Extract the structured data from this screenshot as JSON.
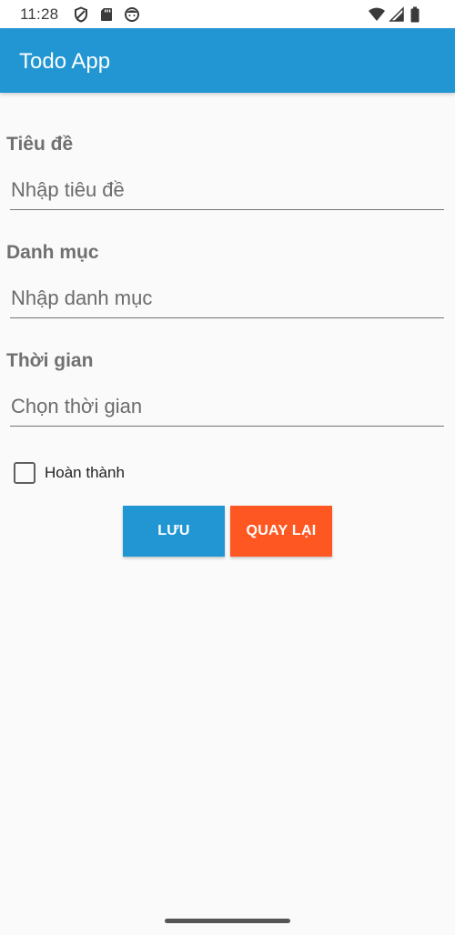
{
  "status_bar": {
    "time": "11:28",
    "left_icons": [
      "shield-icon",
      "sd-card-icon",
      "face-icon"
    ],
    "right_icons": [
      "wifi-icon",
      "cell-signal-icon",
      "battery-icon"
    ]
  },
  "app_bar": {
    "title": "Todo App",
    "color": "#2196d3"
  },
  "form": {
    "title_label": "Tiêu đề",
    "title_placeholder": "Nhập tiêu đề",
    "title_value": "",
    "category_label": "Danh mục",
    "category_placeholder": "Nhập danh mục",
    "category_value": "",
    "time_label": "Thời gian",
    "time_placeholder": "Chọn thời gian",
    "time_value": "",
    "done_label": "Hoàn thành",
    "done_checked": false
  },
  "actions": {
    "save_label": "LƯU",
    "save_color": "#2196d3",
    "back_label": "QUAY LẠI",
    "back_color": "#ff5722"
  }
}
